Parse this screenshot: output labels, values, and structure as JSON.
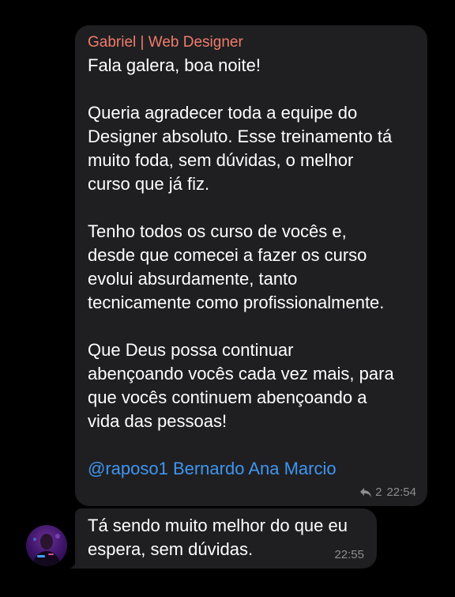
{
  "messages": [
    {
      "sender": "Gabriel | Web Designer",
      "paragraphs": [
        "Fala galera, boa noite!",
        "Queria agradecer toda a equipe do\nDesigner absoluto. Esse treinamento tá\nmuito foda, sem dúvidas, o melhor\ncurso que já fiz.",
        "Tenho todos os curso de vocês e,\ndesde que comecei a fazer os curso\nevolui absurdamente, tanto\ntecnicamente como profissionalmente.",
        "Que Deus possa continuar\nabençoando vocês cada vez mais, para\nque vocês continuem abençoando a\nvida das pessoas!"
      ],
      "mentions": "@raposo1 Bernardo Ana Marcio",
      "reply_count": "2",
      "time": "22:54",
      "reply_icon": "reply-arrow-icon"
    },
    {
      "text": "Tá sendo muito melhor do que eu\nespera, sem dúvidas.",
      "time": "22:55"
    }
  ],
  "colors": {
    "background": "#000000",
    "bubble": "#1f1f21",
    "sender_name": "#f07c6c",
    "mention": "#3f95f0",
    "meta": "#8c8c90"
  }
}
